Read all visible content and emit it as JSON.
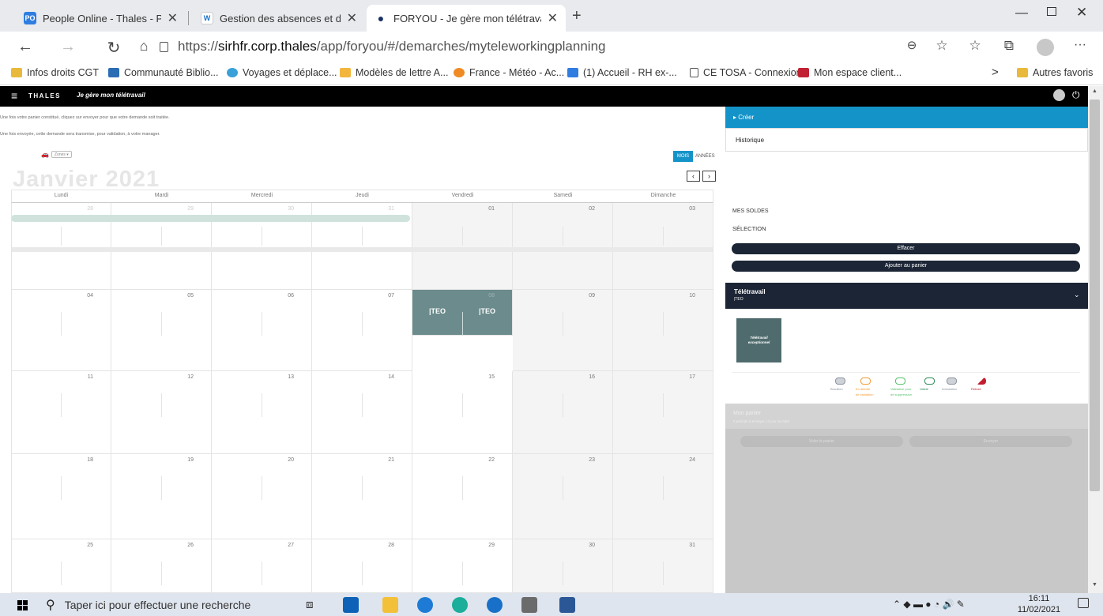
{
  "tabs": [
    {
      "title": "People Online - Thales - People",
      "icon": "PO",
      "color": "#2f7de1",
      "active": false
    },
    {
      "title": "Gestion des absences et des tem",
      "icon": "W",
      "color": "#ffffff",
      "active": false
    },
    {
      "title": "FORYOU - Je gère mon télétrava",
      "icon": "●",
      "color": "#ffffff",
      "active": true
    }
  ],
  "new_tab": "+",
  "url": {
    "scheme": "https://",
    "host": "sirhfr.corp.thales",
    "path": "/app/foryou/#/demarches/myteleworkingplanning"
  },
  "bookmarks": [
    {
      "label": "Infos droits CGT",
      "color": "#e8b93b"
    },
    {
      "label": "Communauté Biblio...",
      "color": "#2a6db5"
    },
    {
      "label": "Voyages et déplace...",
      "color": "#3aa0d8"
    },
    {
      "label": "Modèles de lettre A...",
      "color": "#f2b63d"
    },
    {
      "label": "France - Météo - Ac...",
      "color": "#f08a24"
    },
    {
      "label": "(1) Accueil - RH ex-...",
      "color": "#2f7de1"
    },
    {
      "label": "CE TOSA - Connexion",
      "color": "#ffffff"
    },
    {
      "label": "Mon espace client...",
      "color": "#c02233"
    }
  ],
  "bookmarks_more": ">",
  "other_bookmarks": "Autres favoris",
  "app": {
    "brand": "THALES",
    "title": "Je gère mon télétravail"
  },
  "info_lines": [
    "Une fois votre panier constitué, cliquez sur envoyer pour que votre demande soit traitée.",
    "Une fois envoyée, cette demande sera transmise, pour validation, à votre manager."
  ],
  "zones_label": "Zones",
  "view_toggle": {
    "month": "MOIS",
    "year": "ANNÉES"
  },
  "month_title": "Janvier 2021",
  "days": [
    "Lundi",
    "Mardi",
    "Mercredi",
    "Jeudi",
    "Vendredi",
    "Samedi",
    "Dimanche"
  ],
  "weeks": [
    [
      "28",
      "29",
      "30",
      "31",
      "01",
      "02",
      "03"
    ],
    [
      "04",
      "05",
      "06",
      "07",
      "08",
      "09",
      "10"
    ],
    [
      "11",
      "12",
      "13",
      "14",
      "15",
      "16",
      "17"
    ],
    [
      "18",
      "19",
      "20",
      "21",
      "22",
      "23",
      "24"
    ],
    [
      "25",
      "26",
      "27",
      "28",
      "29",
      "30",
      "31"
    ]
  ],
  "tteo": [
    "|TEO",
    "|TEO"
  ],
  "right": {
    "create": "Créer",
    "history": "Historique",
    "soldes": "MES SOLDES",
    "selection": "SÉLECTION",
    "clear": "Effacer",
    "add_cart": "Ajouter au panier",
    "telework_title": "Télétravail",
    "telework_sub": "|TEO",
    "card_line1": "Télétravail",
    "card_line2": "exceptionnel",
    "legend": [
      {
        "label": "Brouillon",
        "sub": "",
        "color": "#8a93a0"
      },
      {
        "label": "En attente",
        "sub": "de validation",
        "color": "#f39c34"
      },
      {
        "label": "Validation pour",
        "sub": "de suppression",
        "color": "#56c06a"
      },
      {
        "label": "Validé",
        "sub": "",
        "color": "#2e8b57"
      },
      {
        "label": "Annulation",
        "sub": "",
        "color": "#8a93a0"
      },
      {
        "label": "Refusé",
        "sub": "",
        "color": "#c21e2e"
      }
    ],
    "cart_title": "Mon panier",
    "cart_sub": "0 période à envoyer | 0 jour au total",
    "empty_cart": "Vider le panier",
    "send": "Envoyer"
  },
  "taskbar": {
    "search": "Taper ici pour effectuer une recherche",
    "time": "16:11",
    "date": "11/02/2021"
  }
}
